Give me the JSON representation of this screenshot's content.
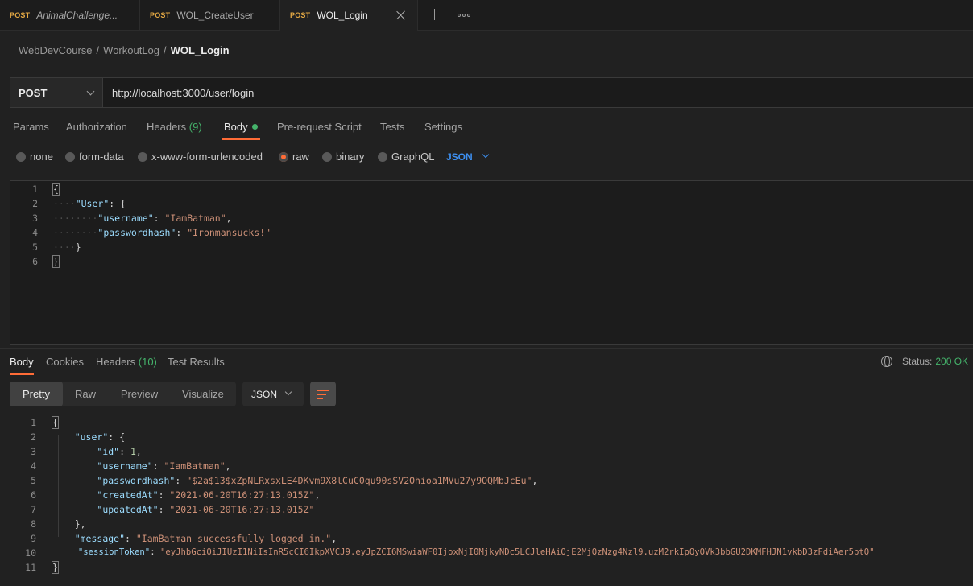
{
  "tabs": [
    {
      "method": "POST",
      "name": "AnimalChallenge..."
    },
    {
      "method": "POST",
      "name": "WOL_CreateUser"
    },
    {
      "method": "POST",
      "name": "WOL_Login"
    }
  ],
  "icons": {
    "close": "close-icon",
    "add": "plus-icon",
    "more": "more-icon",
    "chevron": "chevron-down-icon",
    "globe": "globe-icon",
    "wrap": "wrap-lines-icon"
  },
  "colors": {
    "accent": "#ff6c37",
    "success": "#45b36b",
    "method": "#e5a944",
    "link": "#3d8ff0"
  },
  "breadcrumb": {
    "a": "WebDevCourse",
    "b": "WorkoutLog",
    "c": "WOL_Login",
    "sep": "/"
  },
  "request": {
    "method": "POST",
    "url": "http://localhost:3000/user/login"
  },
  "request_tabs": {
    "params": "Params",
    "authorization": "Authorization",
    "headers": "Headers",
    "headers_count": "(9)",
    "body": "Body",
    "prerequest": "Pre-request Script",
    "tests": "Tests",
    "settings": "Settings"
  },
  "body_types": {
    "none": "none",
    "form_data": "form-data",
    "urlencoded": "x-www-form-urlencoded",
    "raw": "raw",
    "binary": "binary",
    "graphql": "GraphQL",
    "format": "JSON",
    "selected": "raw"
  },
  "request_body": {
    "line_numbers": [
      "1",
      "2",
      "3",
      "4",
      "5",
      "6"
    ],
    "open": "{",
    "user_key": "\"User\"",
    "username_key": "\"username\"",
    "username_val": "\"IamBatman\"",
    "pw_key": "\"passwordhash\"",
    "pw_val": "\"Ironmansucks!\"",
    "close_inner": "}",
    "close": "}"
  },
  "response_tabs": {
    "body": "Body",
    "cookies": "Cookies",
    "headers": "Headers",
    "headers_count": "(10)",
    "test_results": "Test Results"
  },
  "status": {
    "label": "Status:",
    "code": "200 OK"
  },
  "view_modes": {
    "pretty": "Pretty",
    "raw": "Raw",
    "preview": "Preview",
    "visualize": "Visualize",
    "format": "JSON"
  },
  "response_body": {
    "line_numbers": [
      "1",
      "2",
      "3",
      "4",
      "5",
      "6",
      "7",
      "8",
      "9",
      "10",
      "11"
    ],
    "user_key": "\"user\"",
    "id_key": "\"id\"",
    "id_val": "1",
    "username_key": "\"username\"",
    "username_val": "\"IamBatman\"",
    "pw_key": "\"passwordhash\"",
    "pw_val": "\"$2a$13$xZpNLRxsxLE4DKvm9X8lCuC0qu90sSV2Ohioa1MVu27y9OQMbJcEu\"",
    "created_key": "\"createdAt\"",
    "created_val": "\"2021-06-20T16:27:13.015Z\"",
    "updated_key": "\"updatedAt\"",
    "updated_val": "\"2021-06-20T16:27:13.015Z\"",
    "message_key": "\"message\"",
    "message_val": "\"IamBatman successfully logged in.\"",
    "token_key": "\"sessionToken\"",
    "token_val": "\"eyJhbGciOiJIUzI1NiIsInR5cCI6IkpXVCJ9.eyJpZCI6MSwiaWF0IjoxNjI0MjkyNDc5LCJleHAiOjE2MjQzNzg4Nzl9.uzM2rkIpQyOVk3bbGU2DKMFHJN1vkbD3zFdiAer5btQ\""
  }
}
